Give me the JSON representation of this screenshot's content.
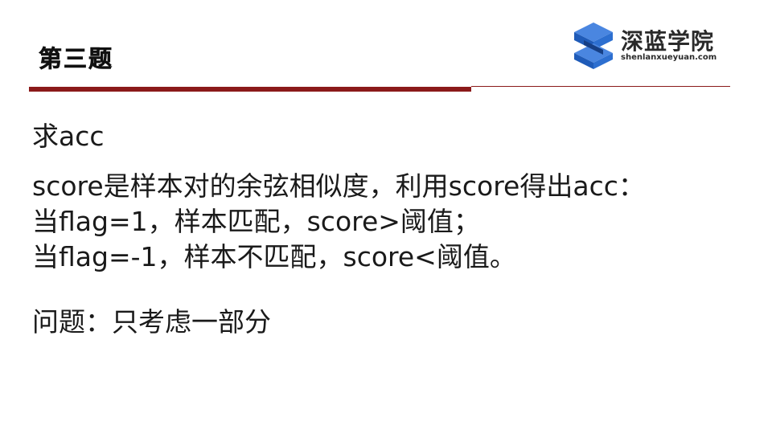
{
  "header": {
    "title": "第三题",
    "accent_color": "#8b1a1a"
  },
  "logo": {
    "name_cn": "深蓝学院",
    "url_text": "shenlanxueyuan.com",
    "brand_color": "#1f5bb8"
  },
  "body": {
    "heading": "求acc",
    "lines": [
      "score是样本对的余弦相似度，利用score得出acc：",
      "当flag=1，样本匹配，score>阈值；",
      "当flag=-1，样本不匹配，score<阈值。"
    ],
    "question": "问题：只考虑一部分"
  }
}
